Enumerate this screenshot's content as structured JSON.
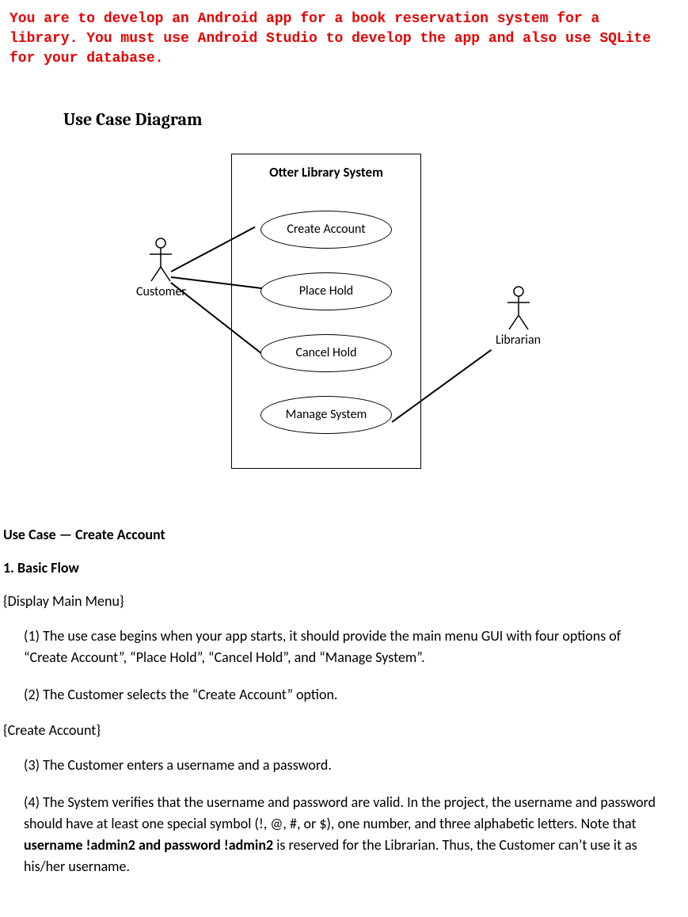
{
  "instruction": "You are to develop an Android app for a book reservation system for a library. You must use Android Studio to develop the app and also use SQLite for your database.",
  "diagram": {
    "title": "Use Case Diagram",
    "system_name": "Otter Library System",
    "usecases": {
      "uc1": "Create Account",
      "uc2": "Place Hold",
      "uc3": "Cancel Hold",
      "uc4": "Manage System"
    },
    "actors": {
      "left": "Customer",
      "right": "Librarian"
    }
  },
  "chart_data": {
    "type": "usecase-diagram",
    "system": "Otter Library System",
    "actors": [
      "Customer",
      "Librarian"
    ],
    "usecases": [
      "Create Account",
      "Place Hold",
      "Cancel Hold",
      "Manage System"
    ],
    "associations": [
      {
        "actor": "Customer",
        "usecase": "Create Account"
      },
      {
        "actor": "Customer",
        "usecase": "Place Hold"
      },
      {
        "actor": "Customer",
        "usecase": "Cancel Hold"
      },
      {
        "actor": "Librarian",
        "usecase": "Manage System"
      }
    ]
  },
  "usecase_section": {
    "name": "Use Case — Create Account",
    "flow_title": "1. Basic Flow",
    "brace1": "{Display Main Menu}",
    "step1": "(1) The use case begins when your app starts, it should provide the main menu GUI with four options of “Create Account”, “Place Hold”, “Cancel Hold”, and “Manage System”.",
    "step2": "(2) The Customer selects the “Create Account” option.",
    "brace2": "{Create Account}",
    "step3": "(3) The Customer enters a username and a password.",
    "step4_a": "(4) The System verifies that the username and password are valid. In the project, the username and password should have at least one special symbol (!, @, #, or $), one number, and three alphabetic letters. Note that ",
    "step4_b": "username !admin2 and password !admin2",
    "step4_c": " is reserved for the Librarian. Thus, the Customer can’t use it as his/her username."
  }
}
